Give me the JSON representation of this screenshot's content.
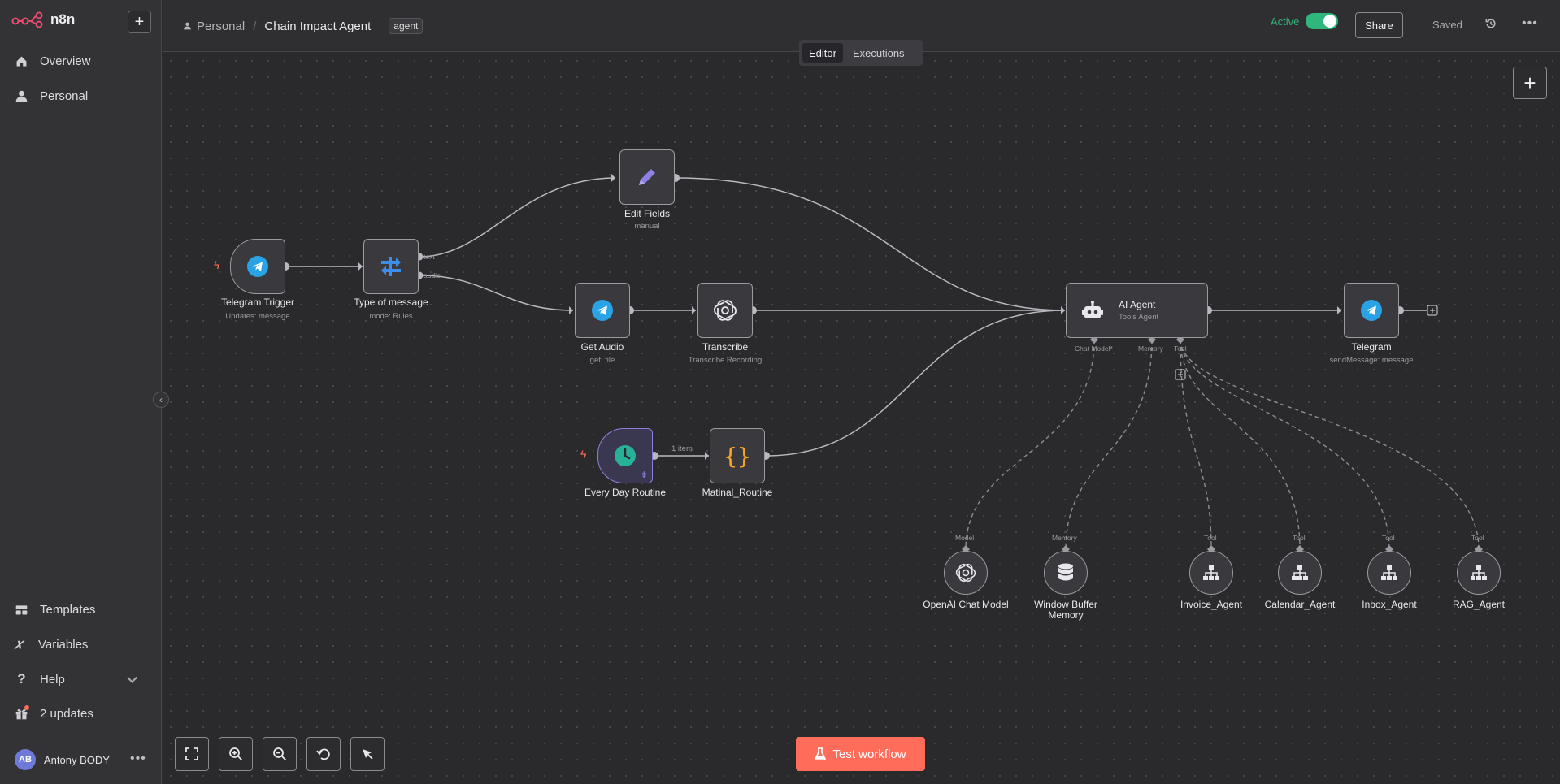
{
  "app": {
    "name": "n8n"
  },
  "sidebar": {
    "items": [
      {
        "label": "Overview",
        "icon": "home-icon"
      },
      {
        "label": "Personal",
        "icon": "user-icon"
      }
    ],
    "bottom_items": [
      {
        "label": "Templates",
        "icon": "templates-icon"
      },
      {
        "label": "Variables",
        "icon": "variables-icon"
      },
      {
        "label": "Help",
        "icon": "help-icon"
      },
      {
        "label": "2 updates",
        "icon": "gift-icon"
      }
    ],
    "user": {
      "initials": "AB",
      "name": "Antony BODY"
    }
  },
  "header": {
    "breadcrumb_project": "Personal",
    "workflow_title": "Chain Impact Agent",
    "tag": "agent",
    "active_label": "Active",
    "active": true,
    "share_label": "Share",
    "saved_label": "Saved"
  },
  "mode_tabs": [
    {
      "label": "Editor",
      "selected": true
    },
    {
      "label": "Executions",
      "selected": false
    }
  ],
  "nodes": {
    "telegram_trigger": {
      "name": "Telegram Trigger",
      "sub": "Updates: message"
    },
    "type_of_message": {
      "name": "Type of message",
      "sub": "mode: Rules",
      "out1": "text",
      "out2": "audio"
    },
    "edit_fields": {
      "name": "Edit Fields",
      "sub": "manual"
    },
    "get_audio": {
      "name": "Get Audio",
      "sub": "get: file"
    },
    "transcribe": {
      "name": "Transcribe",
      "sub": "Transcribe Recording"
    },
    "every_day": {
      "name": "Every Day Routine",
      "edge_label": "1 item"
    },
    "matinal": {
      "name": "Matinal_Routine"
    },
    "ai_agent": {
      "name": "AI Agent",
      "sub": "Tools Agent",
      "port_model": "Chat Model*",
      "port_memory": "Memory",
      "port_tool": "Tool"
    },
    "telegram": {
      "name": "Telegram",
      "sub": "sendMessage: message"
    },
    "openai": {
      "name": "OpenAI Chat Model",
      "port": "Model"
    },
    "memory": {
      "name_line1": "Window Buffer",
      "name_line2": "Memory",
      "port": "Memory"
    },
    "invoice": {
      "name": "Invoice_Agent",
      "port": "Tool"
    },
    "calendar": {
      "name": "Calendar_Agent",
      "port": "Tool"
    },
    "inbox": {
      "name": "Inbox_Agent",
      "port": "Tool"
    },
    "rag": {
      "name": "RAG_Agent",
      "port": "Tool"
    }
  },
  "test_button_label": "Test workflow",
  "colors": {
    "accent": "#ff6d5a",
    "active_green": "#2eb67d",
    "telegram_blue": "#2aa3e6",
    "switch_blue": "#3d8eea",
    "edit_purple": "#8c7fe6",
    "schedule_teal": "#27b197",
    "code_orange": "#f6a623"
  }
}
